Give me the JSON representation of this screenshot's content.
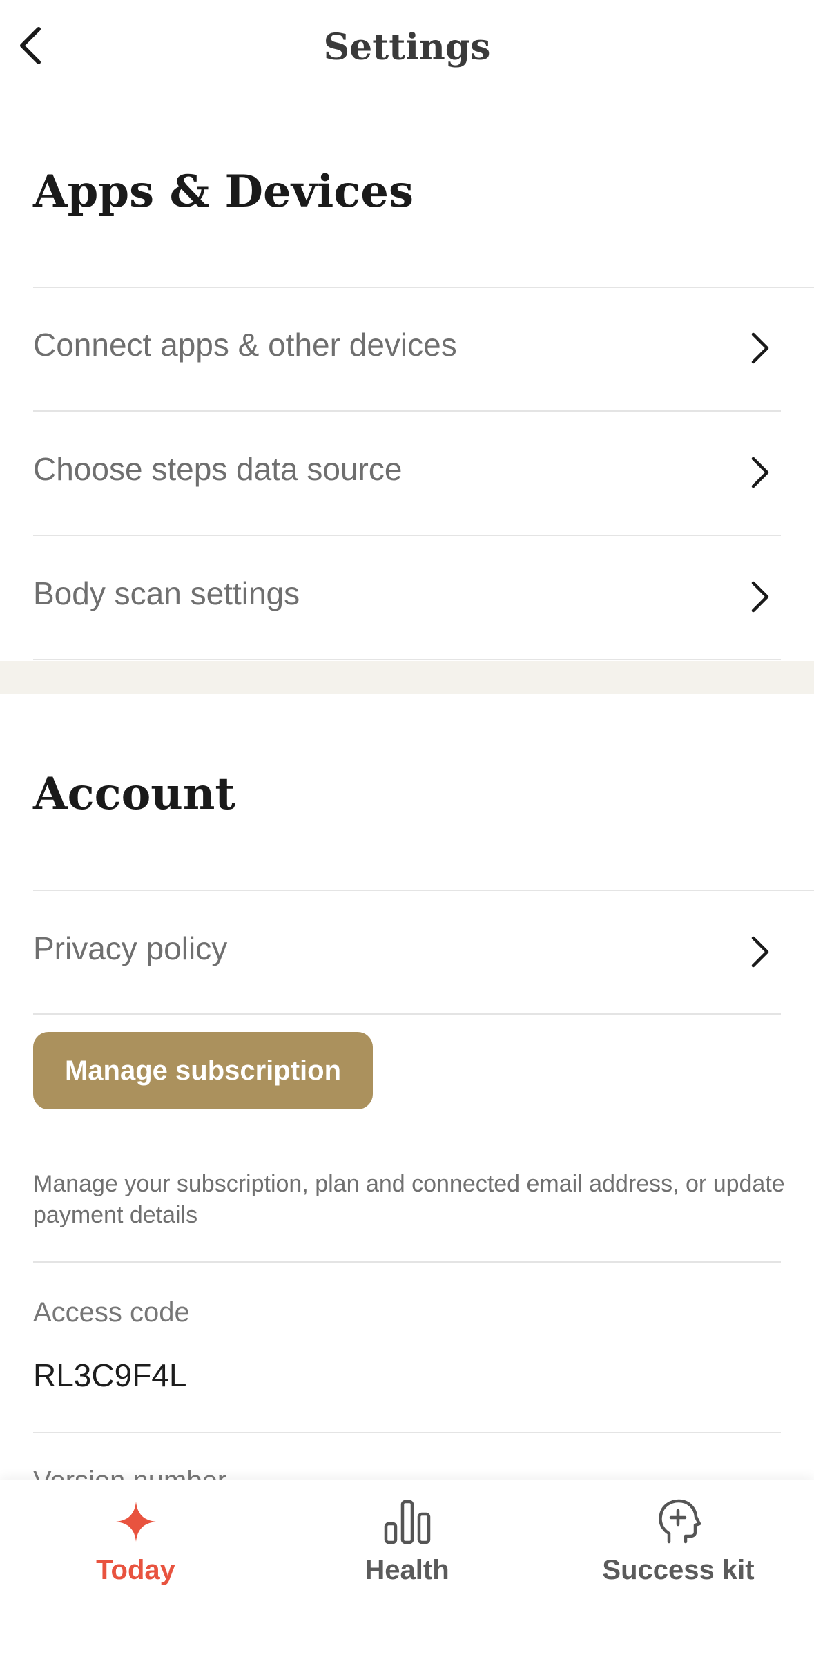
{
  "header": {
    "title": "Settings",
    "back_icon": "chevron-left-icon"
  },
  "apps_devices": {
    "title": "Apps & Devices",
    "items": [
      {
        "label": "Connect apps & other devices"
      },
      {
        "label": "Choose steps data source"
      },
      {
        "label": "Body scan settings"
      }
    ]
  },
  "account": {
    "title": "Account",
    "privacy_label": "Privacy policy",
    "manage_button_label": "Manage subscription",
    "manage_description": "Manage your subscription, plan and connected email address, or update payment details",
    "access_code_label": "Access code",
    "access_code_value": "RL3C9F4L",
    "version_label": "Version number"
  },
  "tabbar": {
    "tabs": [
      {
        "label": "Today",
        "icon": "sparkle-icon",
        "active": true
      },
      {
        "label": "Health",
        "icon": "bar-chart-icon",
        "active": false
      },
      {
        "label": "Success kit",
        "icon": "head-plus-icon",
        "active": false
      }
    ]
  },
  "colors": {
    "accent": "#e8533f",
    "button": "#ab915d",
    "section_band": "#f4f2ec"
  }
}
